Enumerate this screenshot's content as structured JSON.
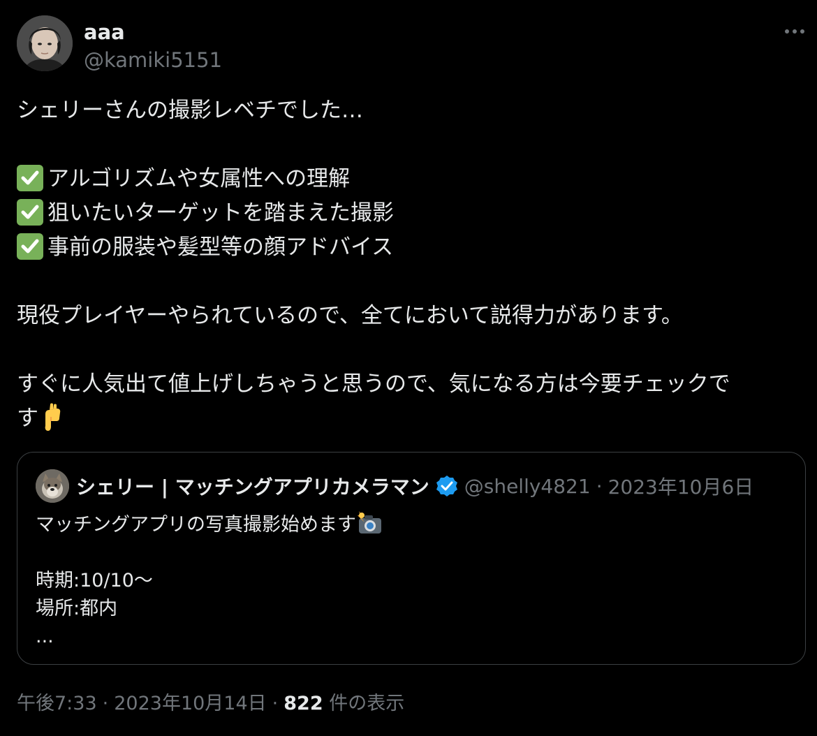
{
  "author": {
    "display_name": "aaa",
    "handle": "@kamiki5151",
    "avatar_icon": "user-avatar-photo"
  },
  "more_icon": "more-options-icon",
  "tweet": {
    "line1": "シェリーさんの撮影レベチでした…",
    "checklist": [
      "アルゴリズムや女属性への理解",
      "狙いたいターゲットを踏まえた撮影",
      "事前の服装や髪型等の顔アドバイス"
    ],
    "check_icon": "white-check-mark-emoji",
    "line5": "現役プレイヤーやられているので、全てにおいて説得力があります。",
    "line6": "すぐに人気出て値上げしちゃうと思うので、気になる方は今要チェックで",
    "line7": "す",
    "hand_icon": "backhand-index-pointing-down-emoji"
  },
  "quote": {
    "name": "シェリー | マッチングアプリカメラマン",
    "verified_icon": "verified-badge-icon",
    "verified_color": "#1d9bf0",
    "handle": "@shelly4821",
    "separator": "·",
    "date": "2023年10月6日",
    "line1": "マッチングアプリの写真撮影始めます",
    "camera_icon": "camera-with-flash-emoji",
    "line2": "時期:10/10〜",
    "line3": "場所:都内",
    "line4": "..."
  },
  "meta": {
    "time": "午後7:33",
    "sep1": "·",
    "date": "2023年10月14日",
    "sep2": "·",
    "views_count": "822",
    "views_label": "件の表示"
  },
  "colors": {
    "background": "#000000",
    "text_primary": "#e7e9ea",
    "text_secondary": "#71767b",
    "border": "#3c4043",
    "check_green": "#78b159"
  }
}
